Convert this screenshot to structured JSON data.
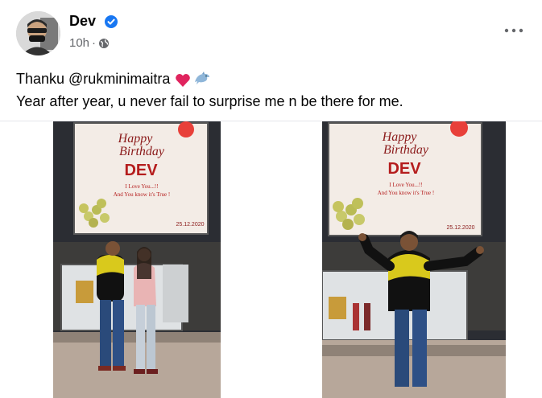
{
  "post": {
    "author": "Dev",
    "time": "10h",
    "text_line1": "Thanku @rukminimaitra",
    "text_line2": "Year after year, u never fail to surprise me n be there for me."
  },
  "icons": {
    "verified": "verified-badge-icon",
    "privacy": "globe-icon",
    "menu": "more-options-icon",
    "emoji1": "red-heart-icon",
    "emoji2": "dolphin-icon"
  },
  "colors": {
    "verified": "#1877f2",
    "meta": "#65676b",
    "text": "#050505"
  },
  "photos": [
    {
      "billboard_line1": "Happy",
      "billboard_line2": "Birthday",
      "billboard_name": "DEV",
      "billboard_msg1": "I Love You...!!",
      "billboard_msg2": "And You know it's True !",
      "billboard_date": "25.12.2020"
    },
    {
      "billboard_line1": "Happy",
      "billboard_line2": "Birthday",
      "billboard_name": "DEV",
      "billboard_msg1": "I Love You...!!",
      "billboard_msg2": "And You know it's True !",
      "billboard_date": "25.12.2020"
    }
  ]
}
